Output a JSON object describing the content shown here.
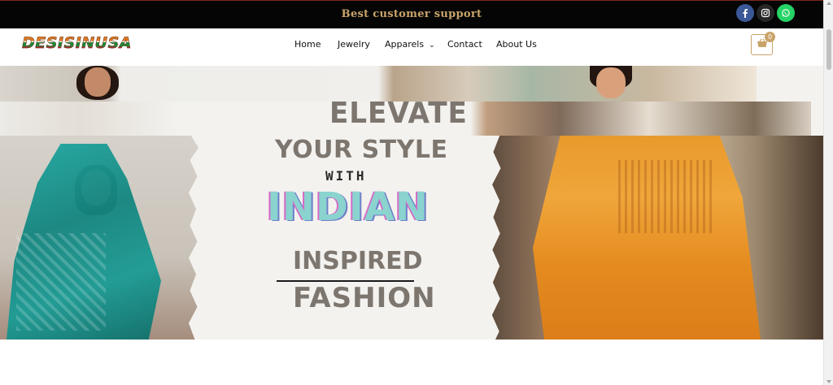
{
  "topbar": {
    "support_text": "Best customer support",
    "social": [
      "facebook-icon",
      "instagram-icon",
      "whatsapp-icon"
    ],
    "colors": {
      "facebook": "#3b5998",
      "instagram": "#262626",
      "whatsapp": "#25d366"
    }
  },
  "header": {
    "logo_text": "DESISINUSA",
    "nav": {
      "home": "Home",
      "jewelry": "Jewelry",
      "apparels": "Apparels",
      "contact": "Contact",
      "about": "About Us"
    },
    "cart_count": "0",
    "accent_color": "#c9a46a"
  },
  "hero": {
    "line1": "ELEVATE",
    "line2": "YOUR STYLE",
    "line3": "WITH",
    "line4": "INDIAN",
    "line5": "INSPIRED",
    "line6": "FASHION"
  }
}
